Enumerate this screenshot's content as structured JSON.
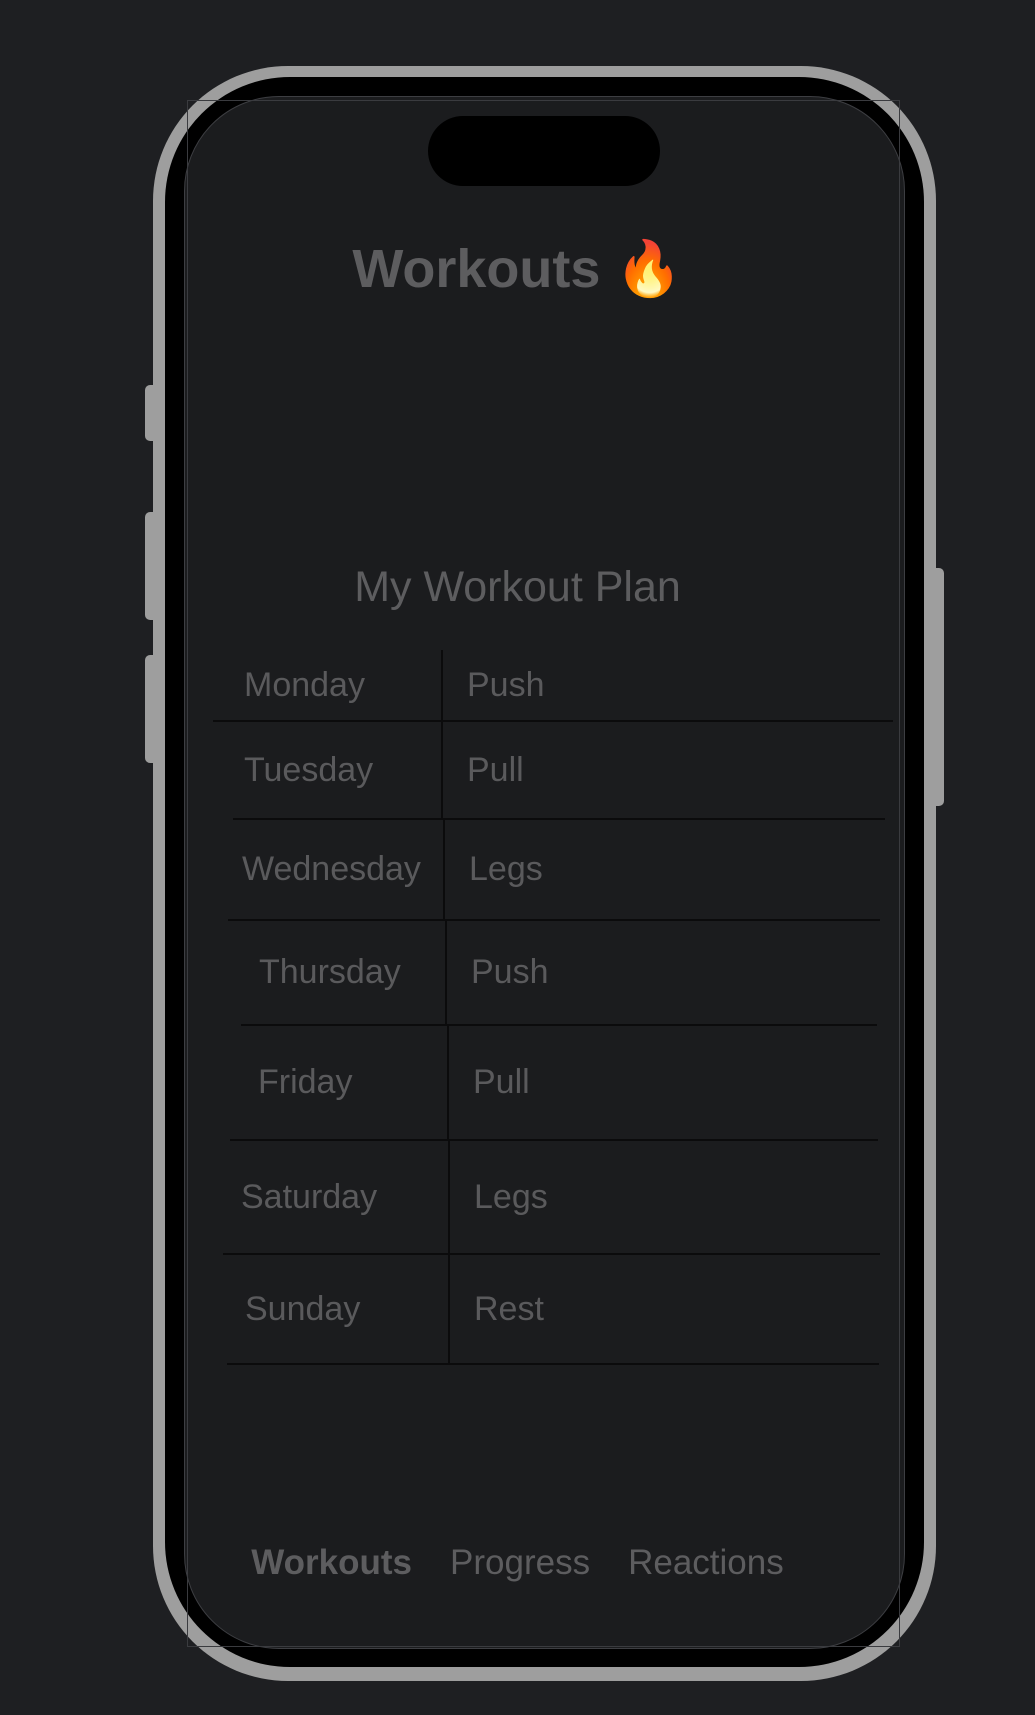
{
  "header": {
    "title": "Workouts",
    "title_emoji": "🔥",
    "title_emoji_name": "fire-icon"
  },
  "plan": {
    "title": "My Workout Plan",
    "rows": [
      {
        "day": "Monday",
        "workout": "Push"
      },
      {
        "day": "Tuesday",
        "workout": "Pull"
      },
      {
        "day": "Wednesday",
        "workout": "Legs"
      },
      {
        "day": "Thursday",
        "workout": "Push"
      },
      {
        "day": "Friday",
        "workout": "Pull"
      },
      {
        "day": "Saturday",
        "workout": "Legs"
      },
      {
        "day": "Sunday",
        "workout": "Rest"
      }
    ]
  },
  "tabbar": {
    "tabs": [
      {
        "label": "Workouts",
        "active": true
      },
      {
        "label": "Progress",
        "active": false
      },
      {
        "label": "Reactions",
        "active": false
      }
    ]
  },
  "colors": {
    "background": "#1e1f22",
    "screen": "#1b1c1e",
    "text": "#5d5d5f",
    "frame": "#9e9e9e"
  }
}
